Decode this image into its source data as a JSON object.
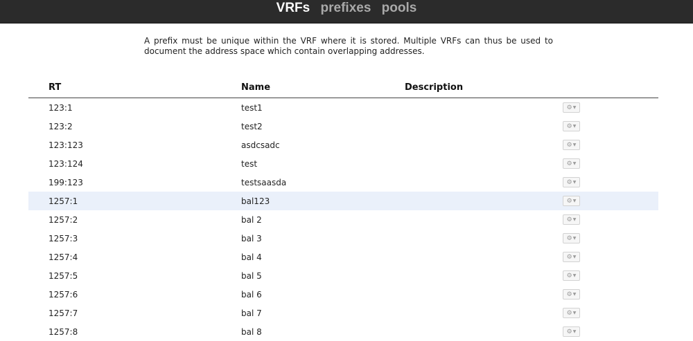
{
  "nav": {
    "items": [
      {
        "label": "VRFs",
        "active": true
      },
      {
        "label": "prefixes",
        "active": false
      },
      {
        "label": "pools",
        "active": false
      }
    ]
  },
  "intro": {
    "text": "A prefix must be unique within the VRF where it is stored. Multiple VRFs can thus be used to document the address space which contain overlapping addresses."
  },
  "table": {
    "headers": {
      "rt": "RT",
      "name": "Name",
      "description": "Description"
    },
    "rows": [
      {
        "rt": "123:1",
        "name": "test1",
        "description": "",
        "action_icon": "gear-icon"
      },
      {
        "rt": "123:2",
        "name": "test2",
        "description": "",
        "action_icon": "gear-icon"
      },
      {
        "rt": "123:123",
        "name": "asdcsadc",
        "description": "",
        "action_icon": "gear-icon"
      },
      {
        "rt": "123:124",
        "name": "test",
        "description": "",
        "action_icon": "gear-icon"
      },
      {
        "rt": "199:123",
        "name": "testsaasda",
        "description": "",
        "action_icon": "gear-icon"
      },
      {
        "rt": "1257:1",
        "name": "bal123",
        "description": "",
        "action_icon": "gear-icon",
        "highlighted": true
      },
      {
        "rt": "1257:2",
        "name": "bal 2",
        "description": "",
        "action_icon": "gear-icon"
      },
      {
        "rt": "1257:3",
        "name": "bal 3",
        "description": "",
        "action_icon": "gear-icon"
      },
      {
        "rt": "1257:4",
        "name": "bal 4",
        "description": "",
        "action_icon": "gear-icon"
      },
      {
        "rt": "1257:5",
        "name": "bal 5",
        "description": "",
        "action_icon": "gear-icon"
      },
      {
        "rt": "1257:6",
        "name": "bal 6",
        "description": "",
        "action_icon": "gear-icon"
      },
      {
        "rt": "1257:7",
        "name": "bal 7",
        "description": "",
        "action_icon": "gear-icon"
      },
      {
        "rt": "1257:8",
        "name": "bal 8",
        "description": "",
        "action_icon": "gear-icon"
      }
    ]
  },
  "colors": {
    "topbar": "#2b2b2b",
    "nav_active": "#ffffff",
    "nav_inactive": "#a9a9a9",
    "row_highlight": "#eaf0fa"
  }
}
